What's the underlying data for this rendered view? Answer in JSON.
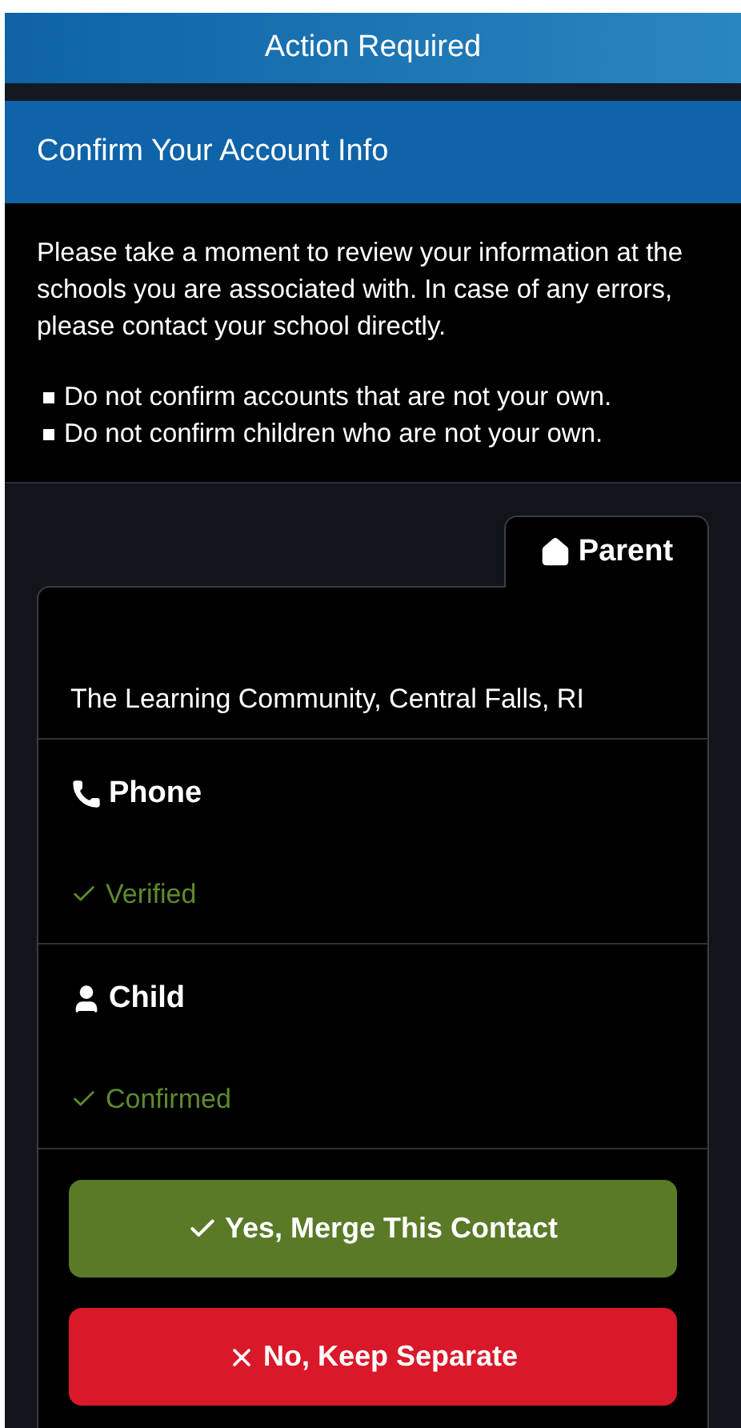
{
  "header": {
    "title": "Action Required"
  },
  "section": {
    "title": "Confirm Your Account Info"
  },
  "intro": "Please take a moment to review your information at the schools you are associated with. In case of any errors, please contact your school directly.",
  "rules": [
    "Do not confirm accounts that are not your own.",
    "Do not confirm children who are not your own."
  ],
  "tab": {
    "label": "Parent",
    "selected": true
  },
  "school": "The Learning Community, Central Falls, RI",
  "items": [
    {
      "kind": "phone",
      "label": "Phone",
      "status": "Verified"
    },
    {
      "kind": "child",
      "label": "Child",
      "status": "Confirmed"
    }
  ],
  "buttons": [
    {
      "kind": "confirm",
      "label": "Yes, Merge This Contact"
    },
    {
      "kind": "reject",
      "label": "No, Keep Separate"
    }
  ]
}
